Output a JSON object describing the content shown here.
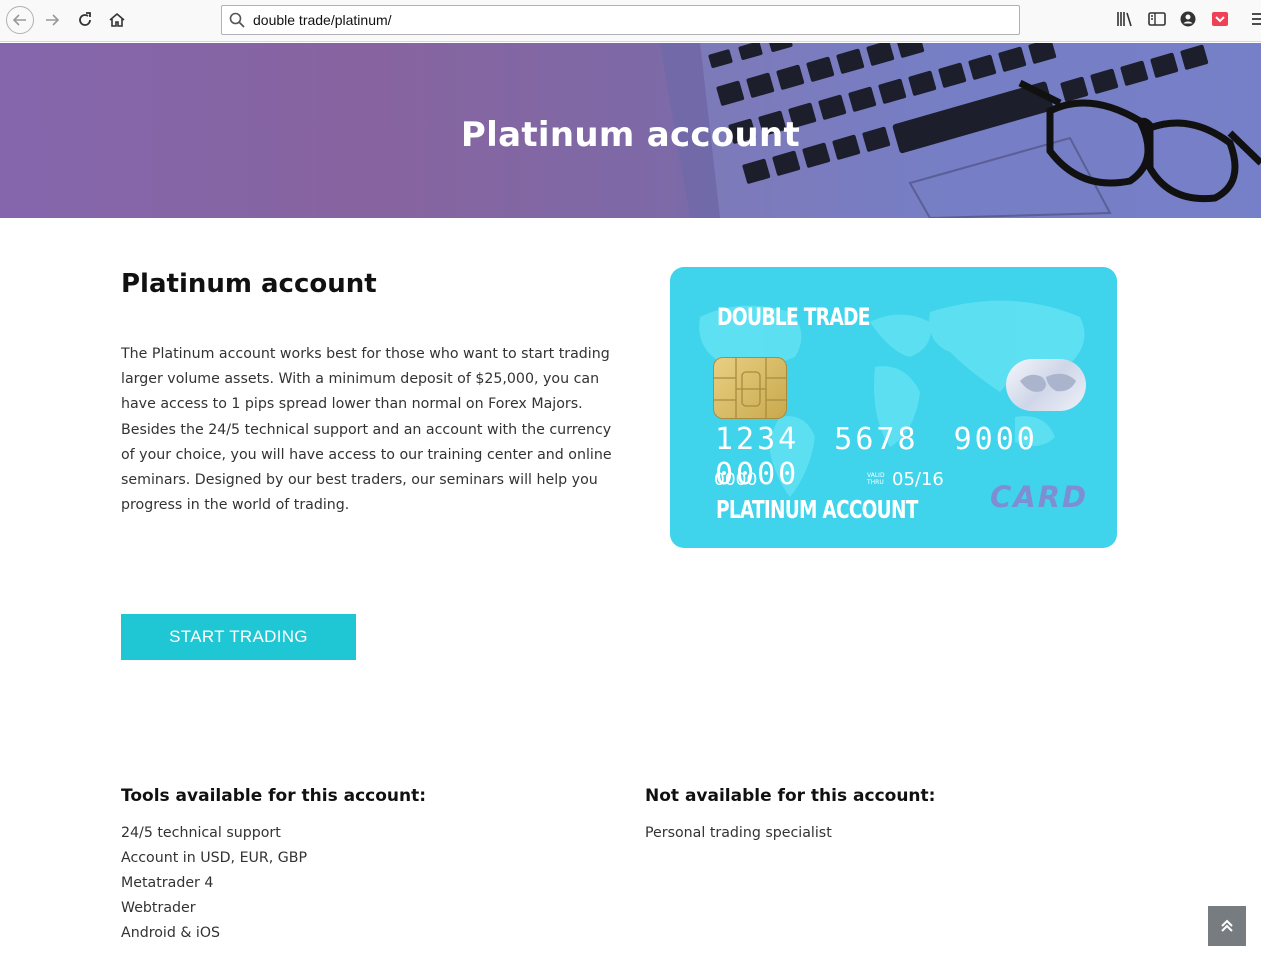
{
  "browser": {
    "url": "double trade/platinum/"
  },
  "hero": {
    "title": "Platinum account"
  },
  "main": {
    "heading": "Platinum account",
    "description": "The Platinum account works best for those who want to start trading larger volume assets. With a minimum deposit of $25,000, you can have access to 1 pips spread lower than normal on Forex Majors. Besides the 24/5 technical support and an account with the currency of your choice, you will have access to our training center and online seminars. Designed by our best traders, our seminars will help you progress in the world of trading.",
    "cta_label": "START TRADING"
  },
  "card": {
    "brand": "DOUBLE TRADE",
    "number": "1234 5678 9000 0000",
    "small_number": "0000",
    "valid_label": "VALID THRU",
    "expiry": "05/16",
    "account_type": "PLATINUM ACCOUNT",
    "card_word": "CARD"
  },
  "tools": {
    "title": "Tools available for this account:",
    "items": [
      "24/5 technical support",
      "Account in USD, EUR, GBP",
      "Metatrader 4",
      "Webtrader",
      "Android & iOS"
    ]
  },
  "not_available": {
    "title": "Not available for this account:",
    "items": [
      "Personal trading specialist"
    ]
  },
  "colors": {
    "accent": "#1fc6d4",
    "card": "#3fd4ec",
    "hero_left": "#8566ad",
    "hero_right": "#6a78c9"
  }
}
